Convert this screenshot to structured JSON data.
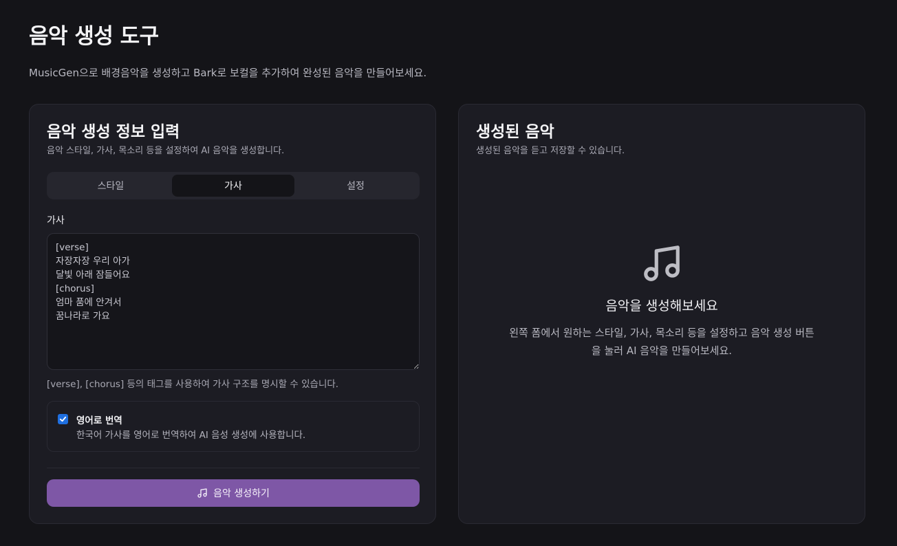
{
  "header": {
    "title": "음악 생성 도구",
    "description": "MusicGen으로 배경음악을 생성하고 Bark로 보컬을 추가하여 완성된 음악을 만들어보세요."
  },
  "form": {
    "title": "음악 생성 정보 입력",
    "subtitle": "음악 스타일, 가사, 목소리 등을 설정하여 AI 음악을 생성합니다.",
    "tabs": [
      {
        "label": "스타일",
        "active": false
      },
      {
        "label": "가사",
        "active": true
      },
      {
        "label": "설정",
        "active": false
      }
    ],
    "lyrics": {
      "label": "가사",
      "value": "[verse]\n자장자장 우리 아가\n달빛 아래 잠들어요\n[chorus]\n엄마 품에 안겨서\n꿈나라로 가요",
      "hint": "[verse], [chorus] 등의 태그를 사용하여 가사 구조를 명시할 수 있습니다."
    },
    "translate": {
      "checked": true,
      "label": "영어로 번역",
      "description": "한국어 가사를 영어로 번역하여 AI 음성 생성에 사용합니다."
    },
    "generate_button": {
      "label": "음악 생성하기",
      "icon": "music-note-icon",
      "color": "#7e57a6"
    }
  },
  "result": {
    "title": "생성된 음악",
    "subtitle": "생성된 음악을 듣고 저장할 수 있습니다.",
    "empty": {
      "icon": "music-note-icon",
      "title": "음악을 생성해보세요",
      "description": "왼쪽 폼에서 원하는 스타일, 가사, 목소리 등을 설정하고 음악 생성 버튼을 눌러 AI 음악을 만들어보세요."
    }
  }
}
